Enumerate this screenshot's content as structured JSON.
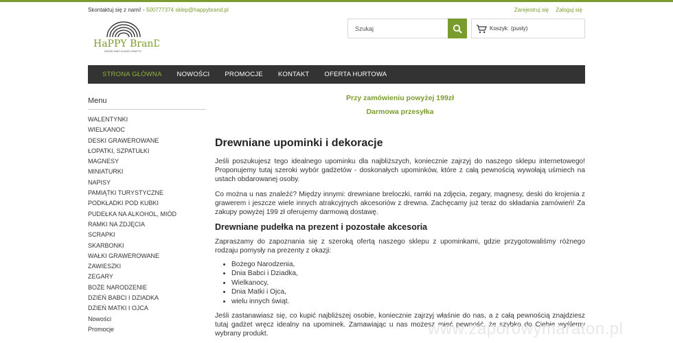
{
  "header": {
    "contact_prefix": "Skontaktuj się z nami! -",
    "phone": "500777374",
    "email": "sklep@happybrand.pl",
    "register": "Zarejestruj się",
    "login": "Zaloguj się",
    "logo_text": "HaPPY BranD",
    "logo_tagline": "WOOD AND GLASS CRAFTS",
    "search_placeholder": "Szukaj",
    "cart_label": "Koszyk:",
    "cart_status": "(pusty)"
  },
  "nav": {
    "items": [
      {
        "label": "Strona główna",
        "active": true
      },
      {
        "label": "Nowości",
        "active": false
      },
      {
        "label": "Promocje",
        "active": false
      },
      {
        "label": "Kontakt",
        "active": false
      },
      {
        "label": "Oferta hurtowa",
        "active": false
      }
    ]
  },
  "sidebar": {
    "title": "Menu",
    "items": [
      "WALENTYNKI",
      "WIELKANOC",
      "DESKI GRAWEROWANE",
      "ŁOPATKI, SZPATUŁKI",
      "MAGNESY",
      "MINIATURKI",
      "NAPISY",
      "PAMIĄTKI TURYSTYCZNE",
      "PODKŁADKI POD KUBKI",
      "PUDEŁKA NA ALKOHOL, MIÓD",
      "RAMKI NA ZDJĘCIA",
      "SCRAPKI",
      "SKARBONKI",
      "WAŁKI GRAWEROWANE",
      "ZAWIESZKI",
      "ZEGARY",
      "BOŻE NARODZENIE",
      "DZIEŃ BABCI I DZIADKA",
      "DZIEŃ MATKI I OJCA",
      "Nowości",
      "Promocje"
    ]
  },
  "content": {
    "promo_line1": "Przy zamówieniu powyżej 199zł",
    "promo_line2": "Darmowa przesyłka",
    "heading": "Drewniane upominki i dekoracje",
    "para1": "Jeśli poszukujesz tego idealnego upominku dla najbliższych, koniecznie zajrzyj do naszego sklepu internetowego! Proponujemy tutaj szeroki wybór gadżetów - doskonałych upominków, które z całą pewnością wywołają uśmiech na ustach obdarowanej osoby.",
    "para2": "Co można u nas znaleźć? Między innymi: drewniane breloczki, ramki na zdjęcia, zegary, magnesy, deski do krojenia z grawerem i jeszcze wiele innych atrakcyjnych akcesoriów z drewna. Zachęcamy już teraz do składania zamówień! Za zakupy powyżej 199 zł oferujemy darmową dostawę.",
    "subheading": "Drewniane pudełka na prezent i pozostałe akcesoria",
    "para3": "Zapraszamy do zapoznania się z szeroką ofertą naszego sklepu z upominkami, gdzie przygotowaliśmy różnego rodzaju pomysły na prezenty z okazji:",
    "occasions": [
      "Bożego Narodzenia,",
      "Dnia Babci i Dziadka,",
      "Wielkanocy,",
      "Dnia Matki i Ojca,",
      "wielu innych świąt."
    ],
    "para4": "Jeśli zastanawiasz się, co kupić najbliższej osobie, koniecznie zajrzyj właśnie do nas, a z całą pewnością znajdziesz tutaj gadżet wręcz idealny na upominek. Zamawiając u nas możesz mieć pewność, że szybko do Ciebie wyślemy wybrany produkt."
  },
  "watermark": "www.zaporowymaraton.pl",
  "colors": {
    "accent": "#7a9c2e",
    "nav_bg": "#333333"
  },
  "icons": {
    "search": "search-icon",
    "cart": "cart-icon"
  }
}
